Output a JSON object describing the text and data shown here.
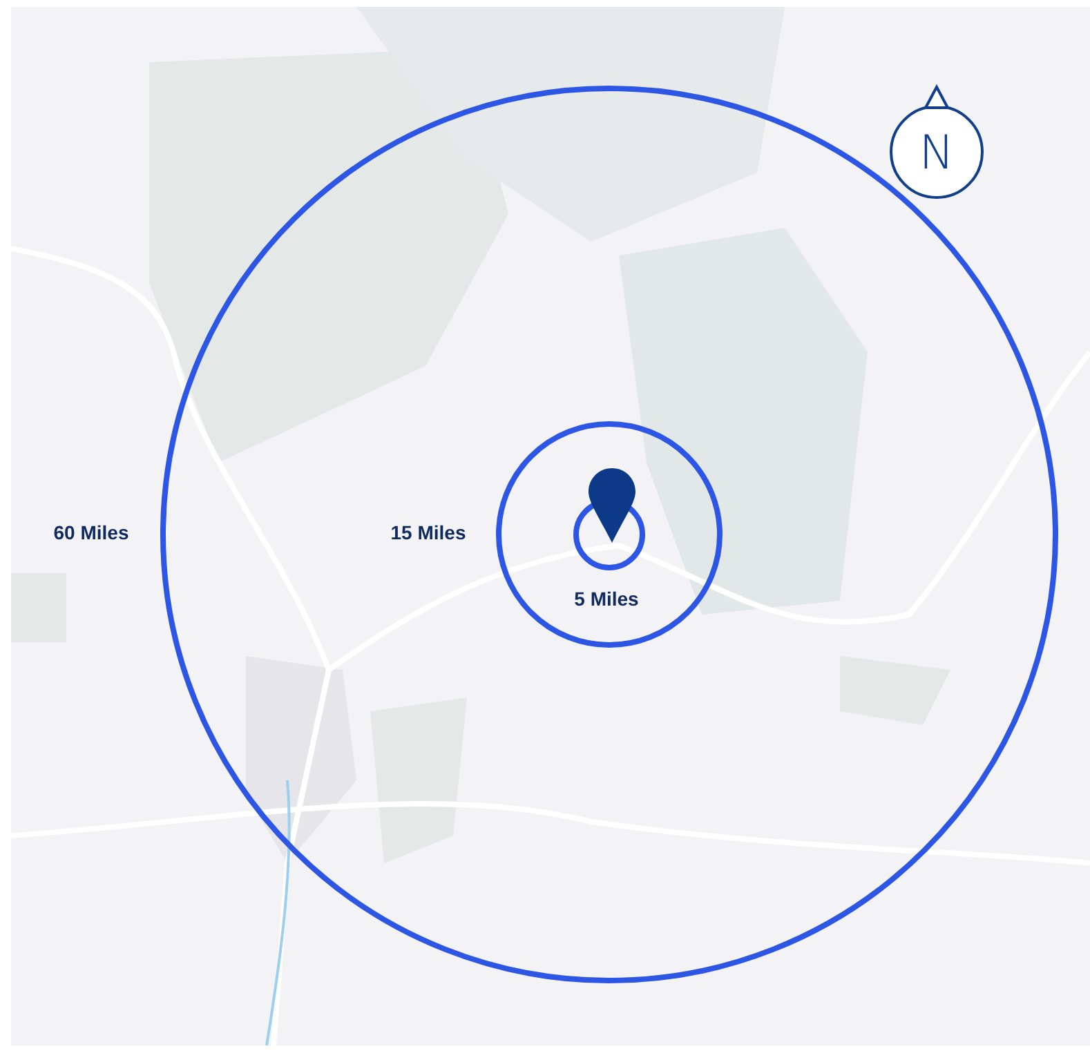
{
  "rings": [
    {
      "label": "60 Miles"
    },
    {
      "label": "15 Miles"
    },
    {
      "label": "5 Miles"
    }
  ],
  "compass": {
    "label": "N"
  }
}
